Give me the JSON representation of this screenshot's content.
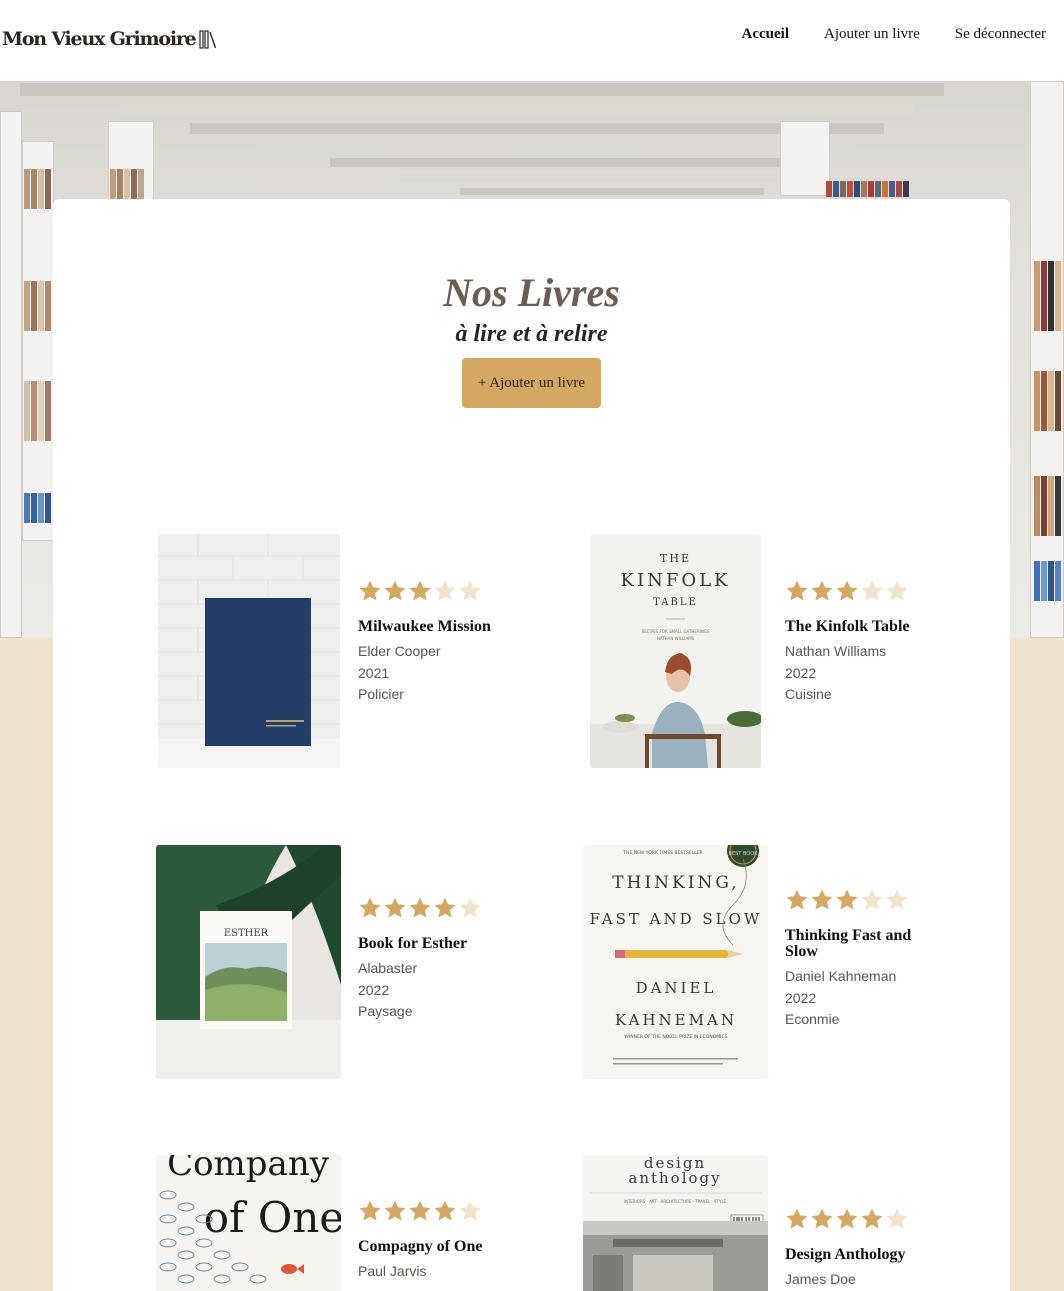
{
  "header": {
    "logo_text": "Mon Vieux Grimoire",
    "nav": [
      {
        "label": "Accueil",
        "active": true
      },
      {
        "label": "Ajouter un livre",
        "active": false
      },
      {
        "label": "Se déconnecter",
        "active": false
      }
    ]
  },
  "page": {
    "title": "Nos Livres",
    "subtitle": "à lire et à relire",
    "add_button": "+ Ajouter un livre"
  },
  "colors": {
    "accent": "#d4a862",
    "star_full": "#d4a862",
    "star_empty": "#f2e3cc",
    "background": "#f1e2cd"
  },
  "books": [
    {
      "title": "Milwaukee Mission",
      "author": "Elder Cooper",
      "year": "2021",
      "genre": "Policier",
      "rating": 3
    },
    {
      "title": "The Kinfolk Table",
      "author": "Nathan Williams",
      "year": "2022",
      "genre": "Cuisine",
      "rating": 3,
      "cover_text": {
        "the": "THE",
        "kinfolk": "KINFOLK",
        "table": "TABLE",
        "tagline": "RECIPES FOR SMALL GATHERINGS",
        "author": "NATHAN WILLIAMS"
      }
    },
    {
      "title": "Book for Esther",
      "author": "Alabaster",
      "year": "2022",
      "genre": "Paysage",
      "rating": 4,
      "cover_text": {
        "title": "ESTHER"
      }
    },
    {
      "title": "Thinking Fast and Slow",
      "author": "Daniel Kahneman",
      "year": "2022",
      "genre": "Econmie",
      "rating": 3,
      "cover_text": {
        "top": "THE NEW YORK TIMES BESTSELLER",
        "badge": "BEST BOOK",
        "line1": "THINKING,",
        "line2": "FAST AND SLOW",
        "author1": "DANIEL",
        "author2": "KAHNEMAN",
        "award": "WINNER OF THE NOBEL PRIZE IN ECONOMICS"
      }
    },
    {
      "title": "Compagny of One",
      "author": "Paul Jarvis",
      "year": "",
      "genre": "",
      "rating": 4,
      "cover_text": {
        "line1": "Company",
        "line2": "of One"
      }
    },
    {
      "title": "Design Anthology",
      "author": "James Doe",
      "year": "",
      "genre": "",
      "rating": 4,
      "cover_text": {
        "line1": "design",
        "line2": "anthology",
        "sections": "INTERIORS · ART · ARCHITECTURE · TRAVEL · STYLE"
      }
    }
  ]
}
